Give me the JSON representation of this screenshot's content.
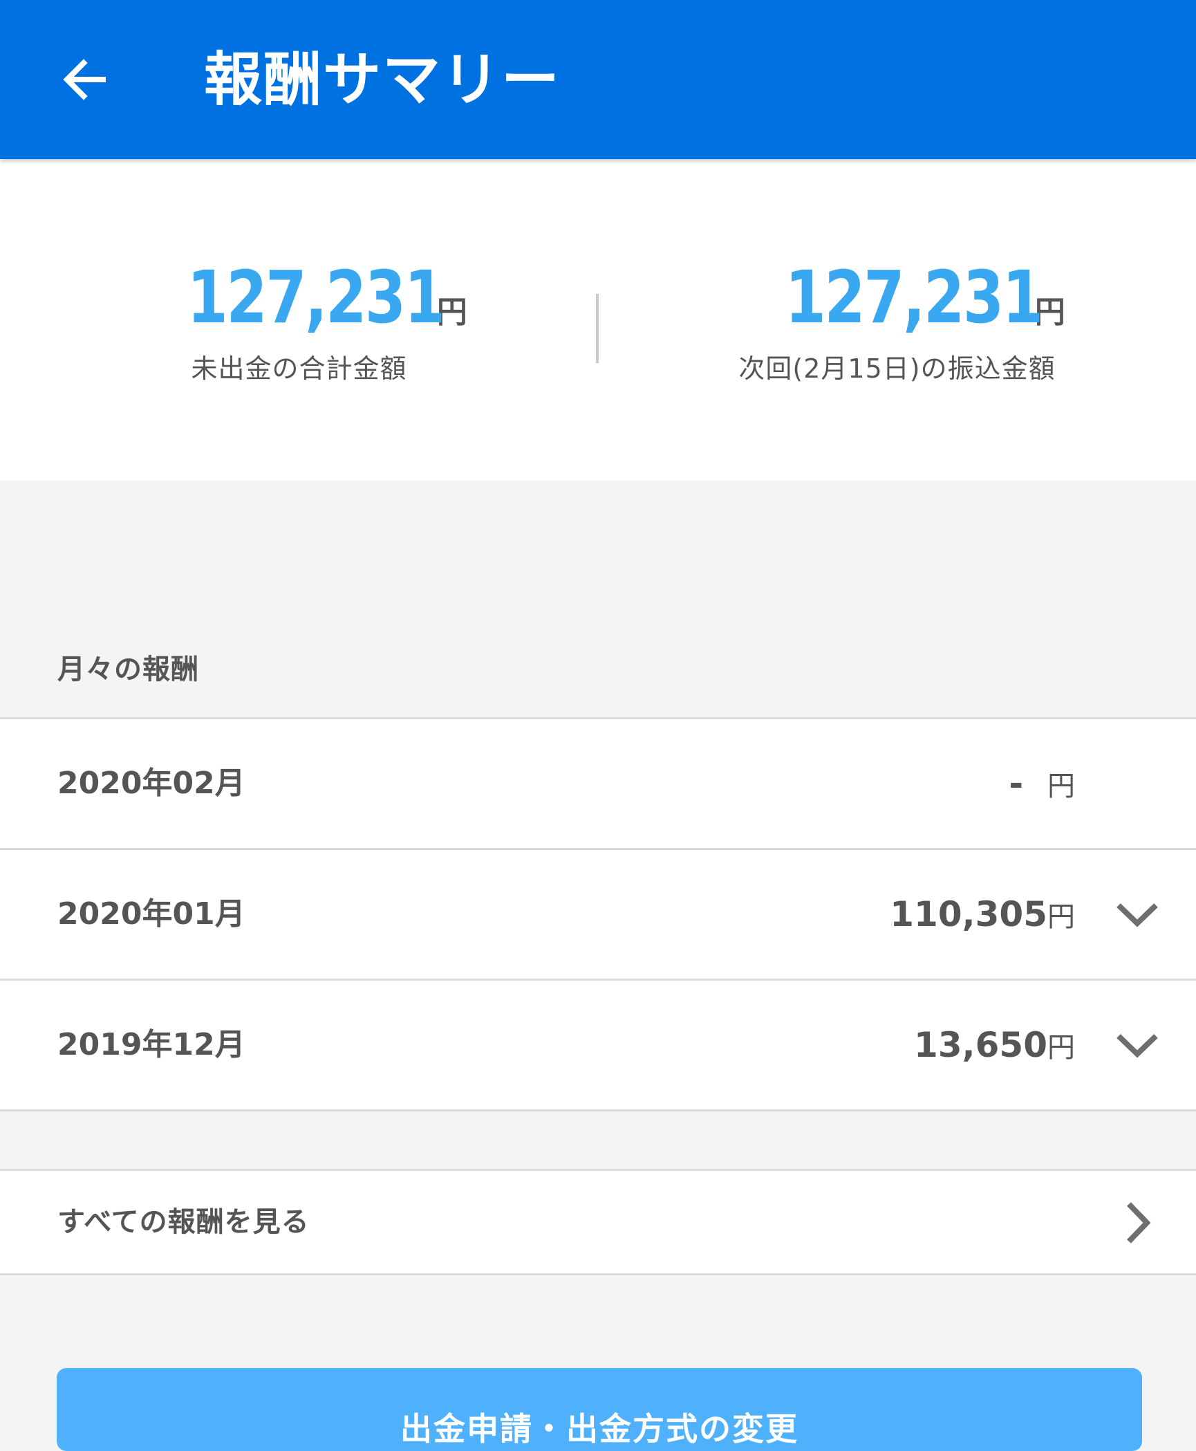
{
  "header": {
    "title": "報酬サマリー",
    "back_icon": "arrow-left-icon",
    "background_color": "#0071e0"
  },
  "summary": {
    "unpaid_total": {
      "amount": "127,231",
      "unit": "円",
      "caption": "未出金の合計金額"
    },
    "next_transfer": {
      "amount": "127,231",
      "unit": "円",
      "caption": "次回(2月15日)の振込金額"
    },
    "amount_color": "#3aa8f0"
  },
  "monthly": {
    "section_title": "月々の報酬",
    "rows": [
      {
        "month": "2020年02月",
        "amount": "-",
        "unit": "円",
        "expandable": false
      },
      {
        "month": "2020年01月",
        "amount": "110,305",
        "unit": "円",
        "expandable": true
      },
      {
        "month": "2019年12月",
        "amount": "13,650",
        "unit": "円",
        "expandable": true
      }
    ]
  },
  "view_all": {
    "label": "すべての報酬を見る",
    "icon": "chevron-right-icon"
  },
  "bottom_button": {
    "label": "出金申請・出金方式の変更",
    "color": "#4fb0fb"
  }
}
